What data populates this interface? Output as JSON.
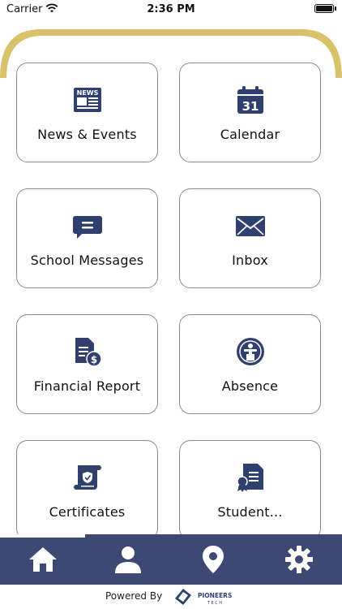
{
  "status": {
    "carrier": "Carrier",
    "time": "2:36 PM"
  },
  "tiles": [
    {
      "label": "News & Events",
      "icon": "news-icon"
    },
    {
      "label": "Calendar",
      "icon": "calendar-icon",
      "badge": "31"
    },
    {
      "label": "School Messages",
      "icon": "message-icon"
    },
    {
      "label": "Inbox",
      "icon": "envelope-icon"
    },
    {
      "label": "Financial Report",
      "icon": "financial-report-icon"
    },
    {
      "label": "Absence",
      "icon": "absence-icon"
    },
    {
      "label": "Certificates",
      "icon": "certificate-icon"
    },
    {
      "label": "Student...",
      "icon": "student-document-icon"
    }
  ],
  "tabbar": {
    "items": [
      "home-icon",
      "user-icon",
      "location-icon",
      "settings-icon"
    ],
    "active": 0
  },
  "footer": {
    "powered_by": "Powered By",
    "brand_name": "PIONEERS",
    "brand_sub": "TECH"
  },
  "colors": {
    "primary": "#3e4875",
    "gold": "#d8c36a",
    "icon": "#2f3f6e"
  },
  "news_icon_text": "NEWS"
}
